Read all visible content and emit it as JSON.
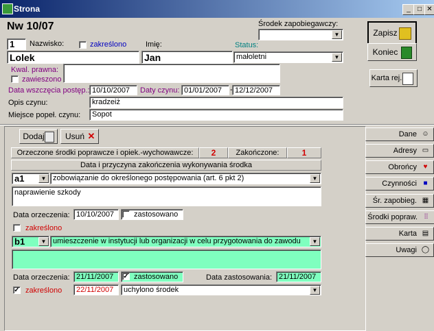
{
  "window": {
    "title": "Strona"
  },
  "case": {
    "number": "Nw 10/07",
    "person_no": "1"
  },
  "labels": {
    "nazwisko": "Nazwisko:",
    "zakreslono": "zakreślono",
    "imie": "Imię:",
    "status": "Status:",
    "srodek_zapobiegawczy": "Środek zapobiegawczy:",
    "kwal_prawna": "Kwal. prawna:",
    "zawieszono": "zawieszono",
    "data_wszczecia": "Data wszczęcia postęp.:",
    "daty_czynu": "Daty czynu:",
    "dash": "-",
    "opis_czynu": "Opis czynu:",
    "miejsce": "Miejsce popeł. czynu:"
  },
  "form": {
    "nazwisko": "Lolek",
    "imie": "Jan",
    "status": "małoletni",
    "srodek_zapobiegawczy": "",
    "kwal_prawna": "",
    "data_wszczecia": "10/10/2007",
    "data_czynu_od": "01/01/2007",
    "data_czynu_do": "12/12/2007",
    "opis_czynu": "kradzeiż",
    "miejsce": "Sopot"
  },
  "buttons": {
    "zapisz": "Zapisz",
    "koniec": "Koniec",
    "karta_rej": "Karta rej.",
    "dodaj": "Dodaj",
    "usun": "Usuń"
  },
  "measures": {
    "header_label": "Orzeczone środki poprawcze i opiek.-wychowawcze:",
    "count": "2",
    "ended_label": "Zakończone:",
    "ended_count": "1",
    "end_reason_header": "Data i przyczyna zakończenia wykonywania środka",
    "data_orzeczenia_label": "Data orzeczenia:",
    "zastosowano_label": "zastosowano",
    "zakreslono_label": "zakreślono",
    "data_zastosowania_label": "Data zastosowania:",
    "items": [
      {
        "code": "a1",
        "description": "zobowiązanie do określonego postępowania (art. 6 pkt 2)",
        "notes": "naprawienie szkody",
        "data_orzeczenia": "10/10/2007"
      },
      {
        "code": "b1",
        "description": "umieszczenie w instytucji lub organizacji w celu przygotowania do zawodu",
        "notes": "",
        "data_orzeczenia": "21/11/2007",
        "data_zastosowania": "21/11/2007",
        "end_date": "22/11/2007",
        "end_reason": "uchylono środek"
      }
    ]
  },
  "tabs": [
    {
      "label": "Dane"
    },
    {
      "label": "Adresy"
    },
    {
      "label": "Obrońcy"
    },
    {
      "label": "Czynności"
    },
    {
      "label": "Śr. zapobieg."
    },
    {
      "label": "Środki popraw."
    },
    {
      "label": "Karta"
    },
    {
      "label": "Uwagi"
    }
  ],
  "colors": {
    "title_start": "#0a246a",
    "highlight_green": "#7fffbf",
    "count_red": "#d00000"
  }
}
